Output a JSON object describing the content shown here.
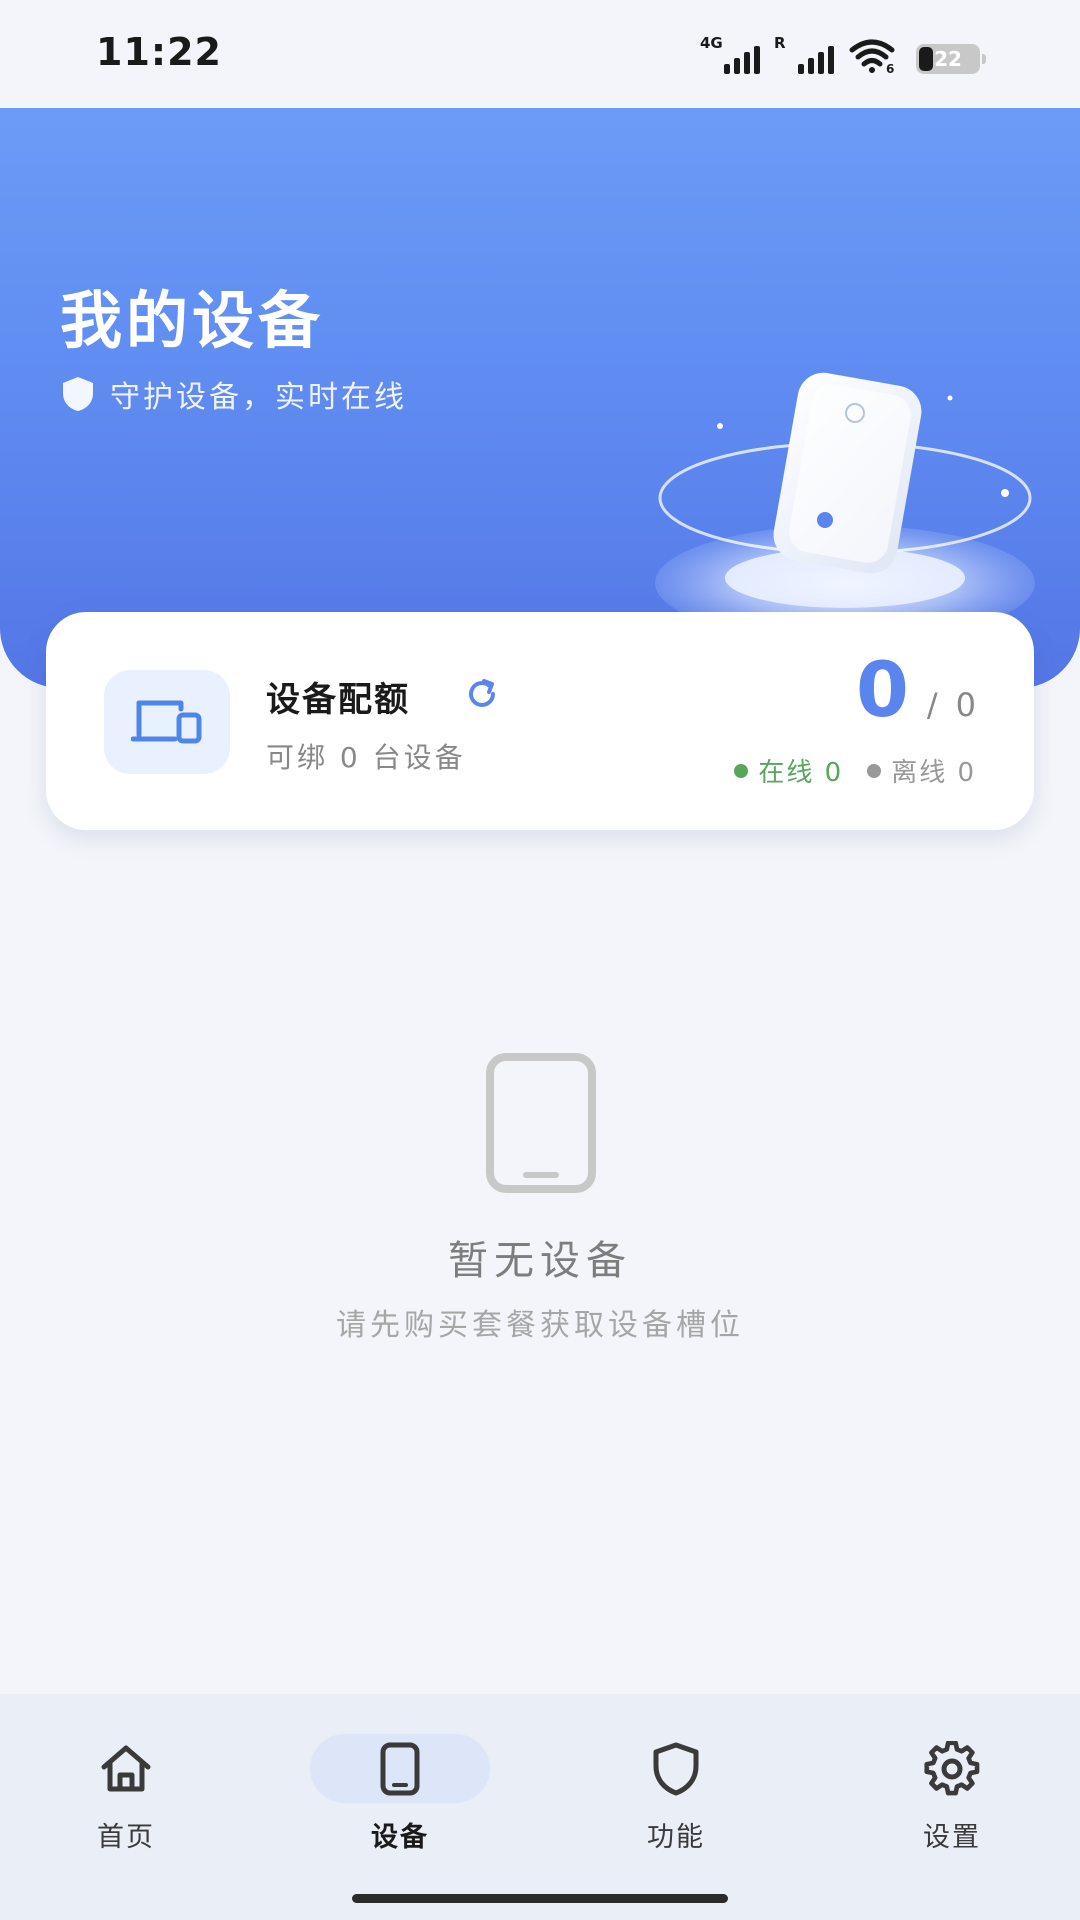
{
  "status_bar": {
    "time": "11:22",
    "signal1_label": "4G",
    "signal2_label": "R",
    "wifi_label": "6",
    "battery": "22"
  },
  "hero": {
    "title": "我的设备",
    "subtitle": "守护设备，实时在线",
    "shield_icon": "shield-icon",
    "illustration": "device-illustration"
  },
  "quota": {
    "title": "设备配额",
    "refresh_icon": "refresh-icon",
    "subtitle": "可绑 0 台设备",
    "count": "0",
    "slash": "/",
    "total": "0",
    "online_label": "在线 0",
    "offline_label": "离线 0",
    "online_color": "#5aa55c",
    "offline_color": "#999999"
  },
  "empty_state": {
    "icon": "tablet-icon",
    "title": "暂无设备",
    "description": "请先购买套餐获取设备槽位"
  },
  "bottom_nav": {
    "items": [
      {
        "label": "首页",
        "icon": "home-icon",
        "active": false
      },
      {
        "label": "设备",
        "icon": "phone-icon",
        "active": true
      },
      {
        "label": "功能",
        "icon": "shield-icon",
        "active": false
      },
      {
        "label": "设置",
        "icon": "gear-icon",
        "active": false
      }
    ]
  },
  "colors": {
    "accent": "#5b85ee",
    "hero_gradient_top": "#6a9cf7",
    "hero_gradient_bottom": "#5476e6",
    "background": "#f3f5fa"
  }
}
